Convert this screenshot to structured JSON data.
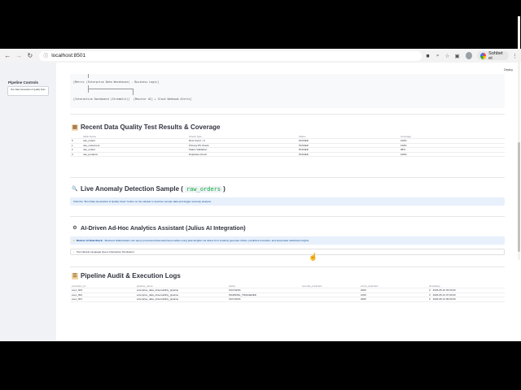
{
  "browser": {
    "url": "localhost:8501",
    "profile_name": "Sohbet et",
    "icons": [
      "back-icon",
      "forward-icon",
      "reload-icon",
      "info-icon",
      "translate-icon",
      "zoom-icon",
      "star-icon",
      "extensions-icon",
      "menu-icon"
    ]
  },
  "app": {
    "deploy_label": "Deploy",
    "sidebar": {
      "title": "Pipeline Controls",
      "run_button_label": "Run Data Generation & Quality Scan"
    },
    "architecture": {
      "line1": "[Metric (Enterprise Data Warehouse) - Business Logic]",
      "line2": "[Interactive Dashboard (Streamlit)]",
      "line3": "[Monitor UI] + Slack Webhook Alerts]"
    },
    "sections": {
      "quality": {
        "icon": "clipboard-icon",
        "title": "Recent Data Quality Test Results & Coverage",
        "columns": [
          "Table Name",
          "Check Type",
          "Status",
          "Coverage"
        ],
        "rows": [
          [
            "raw_orders",
            "Row Count > 0",
            "PASSED",
            "100%"
          ],
          [
            "raw_customers",
            "Primary PK Check",
            "PASSED",
            "100%"
          ],
          [
            "raw_orders",
            "Status Validation",
            "PASSED",
            "98%"
          ],
          [
            "raw_products",
            "Duplicate Check",
            "PASSED",
            "100%"
          ]
        ]
      },
      "anomaly": {
        "icon": "magnifier-icon",
        "title": "Live Anomaly Detection Sample (",
        "code": "raw_orders",
        "title_end": ")",
        "info": "Click the \"Run Data Generation & Quality Scan\" button on the sidebar to load live sample data and trigger anomaly analysis."
      },
      "assistant": {
        "icon": "robot-icon",
        "title": "AI-Driven Ad-Hoc Analytics Assistant (Julius AI Integration)",
        "info_bold": "Modern AI Data Stack:",
        "info": "Business Stakeholders can query processed data warehouse tables using plain English via Julius AI to instantly generate charts, predictive forecasts, and automated statistical insights.",
        "expander": "Test Natural Language Query (Interactive Simulation)"
      },
      "audit": {
        "icon": "scroll-icon",
        "title": "Pipeline Audit & Execution Logs",
        "columns": [
          "execution_id",
          "pipeline_name",
          "status",
          "records_extracted",
          "errors_detected",
          "timestamp"
        ],
        "rows": [
          [
            "exec_903",
            "enterprise_data_observability_pipeline",
            "SUCCESS",
            "",
            "2000",
            "2026-05-10 03:00:00",
            "0"
          ],
          [
            "exec_902",
            "enterprise_data_observability_pipeline",
            "WARNING_TRIGGERED",
            "",
            "1000",
            "2026-05-12 07:00:00",
            "3"
          ],
          [
            "exec_901",
            "enterprise_data_observability_pipeline",
            "SUCCESS",
            "",
            "2000",
            "2026-05-14 09:00:00",
            "0"
          ]
        ]
      }
    }
  }
}
